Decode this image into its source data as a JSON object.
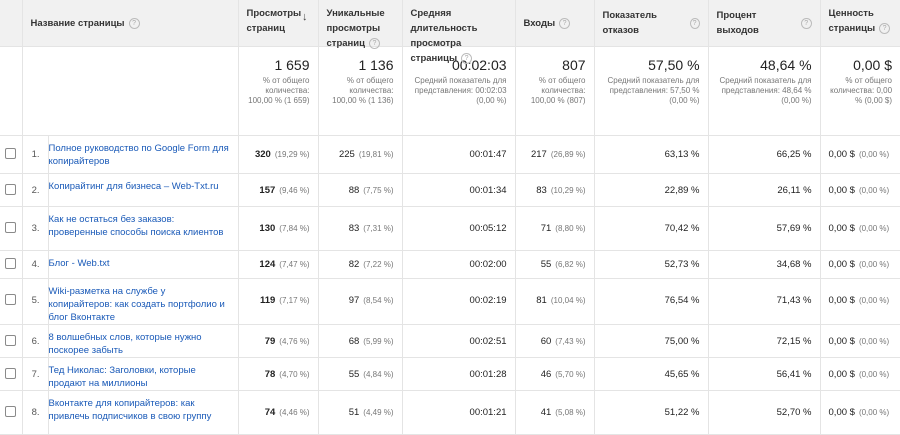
{
  "columns": [
    {
      "label": "Название страницы"
    },
    {
      "label": "Просмотры страниц"
    },
    {
      "label": "Уникальные просмотры страниц"
    },
    {
      "label": "Средняя длительность просмотра страницы"
    },
    {
      "label": "Входы"
    },
    {
      "label": "Показатель отказов"
    },
    {
      "label": "Процент выходов"
    },
    {
      "label": "Ценность страницы"
    }
  ],
  "summary": [
    {
      "value": "1 659",
      "sub": "% от общего количества: 100,00 % (1 659)"
    },
    {
      "value": "1 136",
      "sub": "% от общего количества: 100,00 % (1 136)"
    },
    {
      "value": "00:02:03",
      "sub": "Средний показатель для представления: 00:02:03 (0,00 %)"
    },
    {
      "value": "807",
      "sub": "% от общего количества: 100,00 % (807)"
    },
    {
      "value": "57,50 %",
      "sub": "Средний показатель для представления: 57,50 % (0,00 %)"
    },
    {
      "value": "48,64 %",
      "sub": "Средний показатель для представления: 48,64 % (0,00 %)"
    },
    {
      "value": "0,00 $",
      "sub": "% от общего количества: 0,00 % (0,00 $)"
    }
  ],
  "rows": [
    {
      "idx": "1.",
      "page": "Полное руководство по Google Form для копирайтеров",
      "views": "320",
      "views_pct": "(19,29 %)",
      "uniq": "225",
      "uniq_pct": "(19,81 %)",
      "dur": "00:01:47",
      "ent": "217",
      "ent_pct": "(26,89 %)",
      "bounce": "63,13 %",
      "exit": "66,25 %",
      "val": "0,00 $",
      "val_pct": "(0,00 %)"
    },
    {
      "idx": "2.",
      "page": "Копирайтинг для бизнеса – Web-Txt.ru",
      "views": "157",
      "views_pct": "(9,46 %)",
      "uniq": "88",
      "uniq_pct": "(7,75 %)",
      "dur": "00:01:34",
      "ent": "83",
      "ent_pct": "(10,29 %)",
      "bounce": "22,89 %",
      "exit": "26,11 %",
      "val": "0,00 $",
      "val_pct": "(0,00 %)"
    },
    {
      "idx": "3.",
      "page": "Как не остаться без заказов: проверенные способы поиска клиентов",
      "views": "130",
      "views_pct": "(7,84 %)",
      "uniq": "83",
      "uniq_pct": "(7,31 %)",
      "dur": "00:05:12",
      "ent": "71",
      "ent_pct": "(8,80 %)",
      "bounce": "70,42 %",
      "exit": "57,69 %",
      "val": "0,00 $",
      "val_pct": "(0,00 %)"
    },
    {
      "idx": "4.",
      "page": "Блог - Web.txt",
      "views": "124",
      "views_pct": "(7,47 %)",
      "uniq": "82",
      "uniq_pct": "(7,22 %)",
      "dur": "00:02:00",
      "ent": "55",
      "ent_pct": "(6,82 %)",
      "bounce": "52,73 %",
      "exit": "34,68 %",
      "val": "0,00 $",
      "val_pct": "(0,00 %)"
    },
    {
      "idx": "5.",
      "page": "Wiki-разметка на службе у копирайтеров: как создать портфолио и блог Вконтакте",
      "views": "119",
      "views_pct": "(7,17 %)",
      "uniq": "97",
      "uniq_pct": "(8,54 %)",
      "dur": "00:02:19",
      "ent": "81",
      "ent_pct": "(10,04 %)",
      "bounce": "76,54 %",
      "exit": "71,43 %",
      "val": "0,00 $",
      "val_pct": "(0,00 %)"
    },
    {
      "idx": "6.",
      "page": "8 волшебных слов, которые нужно поскорее забыть",
      "views": "79",
      "views_pct": "(4,76 %)",
      "uniq": "68",
      "uniq_pct": "(5,99 %)",
      "dur": "00:02:51",
      "ent": "60",
      "ent_pct": "(7,43 %)",
      "bounce": "75,00 %",
      "exit": "72,15 %",
      "val": "0,00 $",
      "val_pct": "(0,00 %)"
    },
    {
      "idx": "7.",
      "page": "Тед Николас: Заголовки, которые продают на миллионы",
      "views": "78",
      "views_pct": "(4,70 %)",
      "uniq": "55",
      "uniq_pct": "(4,84 %)",
      "dur": "00:01:28",
      "ent": "46",
      "ent_pct": "(5,70 %)",
      "bounce": "45,65 %",
      "exit": "56,41 %",
      "val": "0,00 $",
      "val_pct": "(0,00 %)"
    },
    {
      "idx": "8.",
      "page": "Вконтакте для копирайтеров: как привлечь подписчиков в свою группу",
      "views": "74",
      "views_pct": "(4,46 %)",
      "uniq": "51",
      "uniq_pct": "(4,49 %)",
      "dur": "00:01:21",
      "ent": "41",
      "ent_pct": "(5,08 %)",
      "bounce": "51,22 %",
      "exit": "52,70 %",
      "val": "0,00 $",
      "val_pct": "(0,00 %)"
    }
  ]
}
